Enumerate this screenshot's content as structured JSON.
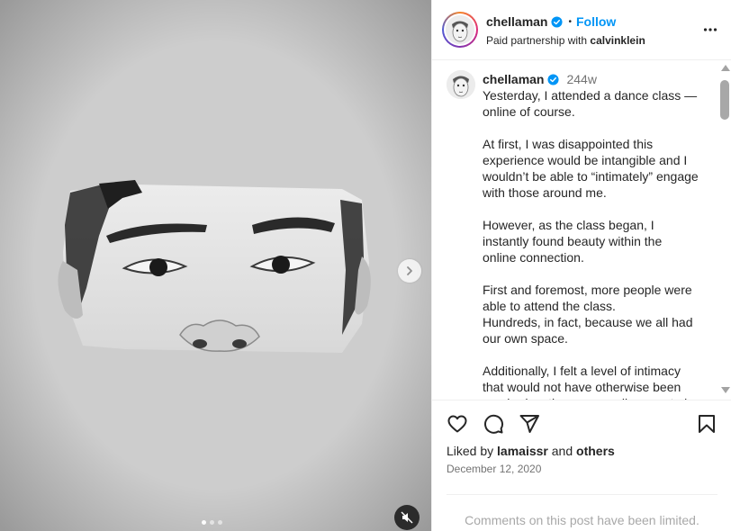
{
  "post": {
    "author": "chellaman",
    "follow_label": "Follow",
    "separator": "•",
    "partnership_prefix": "Paid partnership with",
    "partner": "calvinklein",
    "more_icon": "more-horizontal-icon"
  },
  "caption": {
    "author": "chellaman",
    "time": "244w",
    "paragraphs": [
      "Yesterday, I attended a dance class — online of course.",
      "At first, I was disappointed this experience would be intangible and I wouldn’t be able to “intimately” engage with those around me.",
      "However, as the class began, I instantly found beauty within the online connection.",
      "First and foremost, more people were able to attend the class.\nHundreds, in fact, because we all had our own space.",
      "Additionally, I felt a level of intimacy that would not have otherwise been reached as the camera allows us to be"
    ]
  },
  "actions": {
    "icons": [
      "heart-icon",
      "comment-icon",
      "share-icon",
      "bookmark-icon"
    ],
    "liked_prefix": "Liked by",
    "liked_user": "lamaissr",
    "liked_and": "and",
    "liked_others": "others",
    "date": "December 12, 2020"
  },
  "footer": {
    "limited_text": "Comments on this post have been limited."
  },
  "media": {
    "carousel_dots": 3,
    "active_dot": 0,
    "next_icon": "chevron-right-icon",
    "mute_icon": "muted-speaker-icon"
  },
  "colors": {
    "accent": "#0095f6",
    "verified": "#0095f6",
    "muted_text": "#737373",
    "limited_text": "#a8a8a8"
  }
}
